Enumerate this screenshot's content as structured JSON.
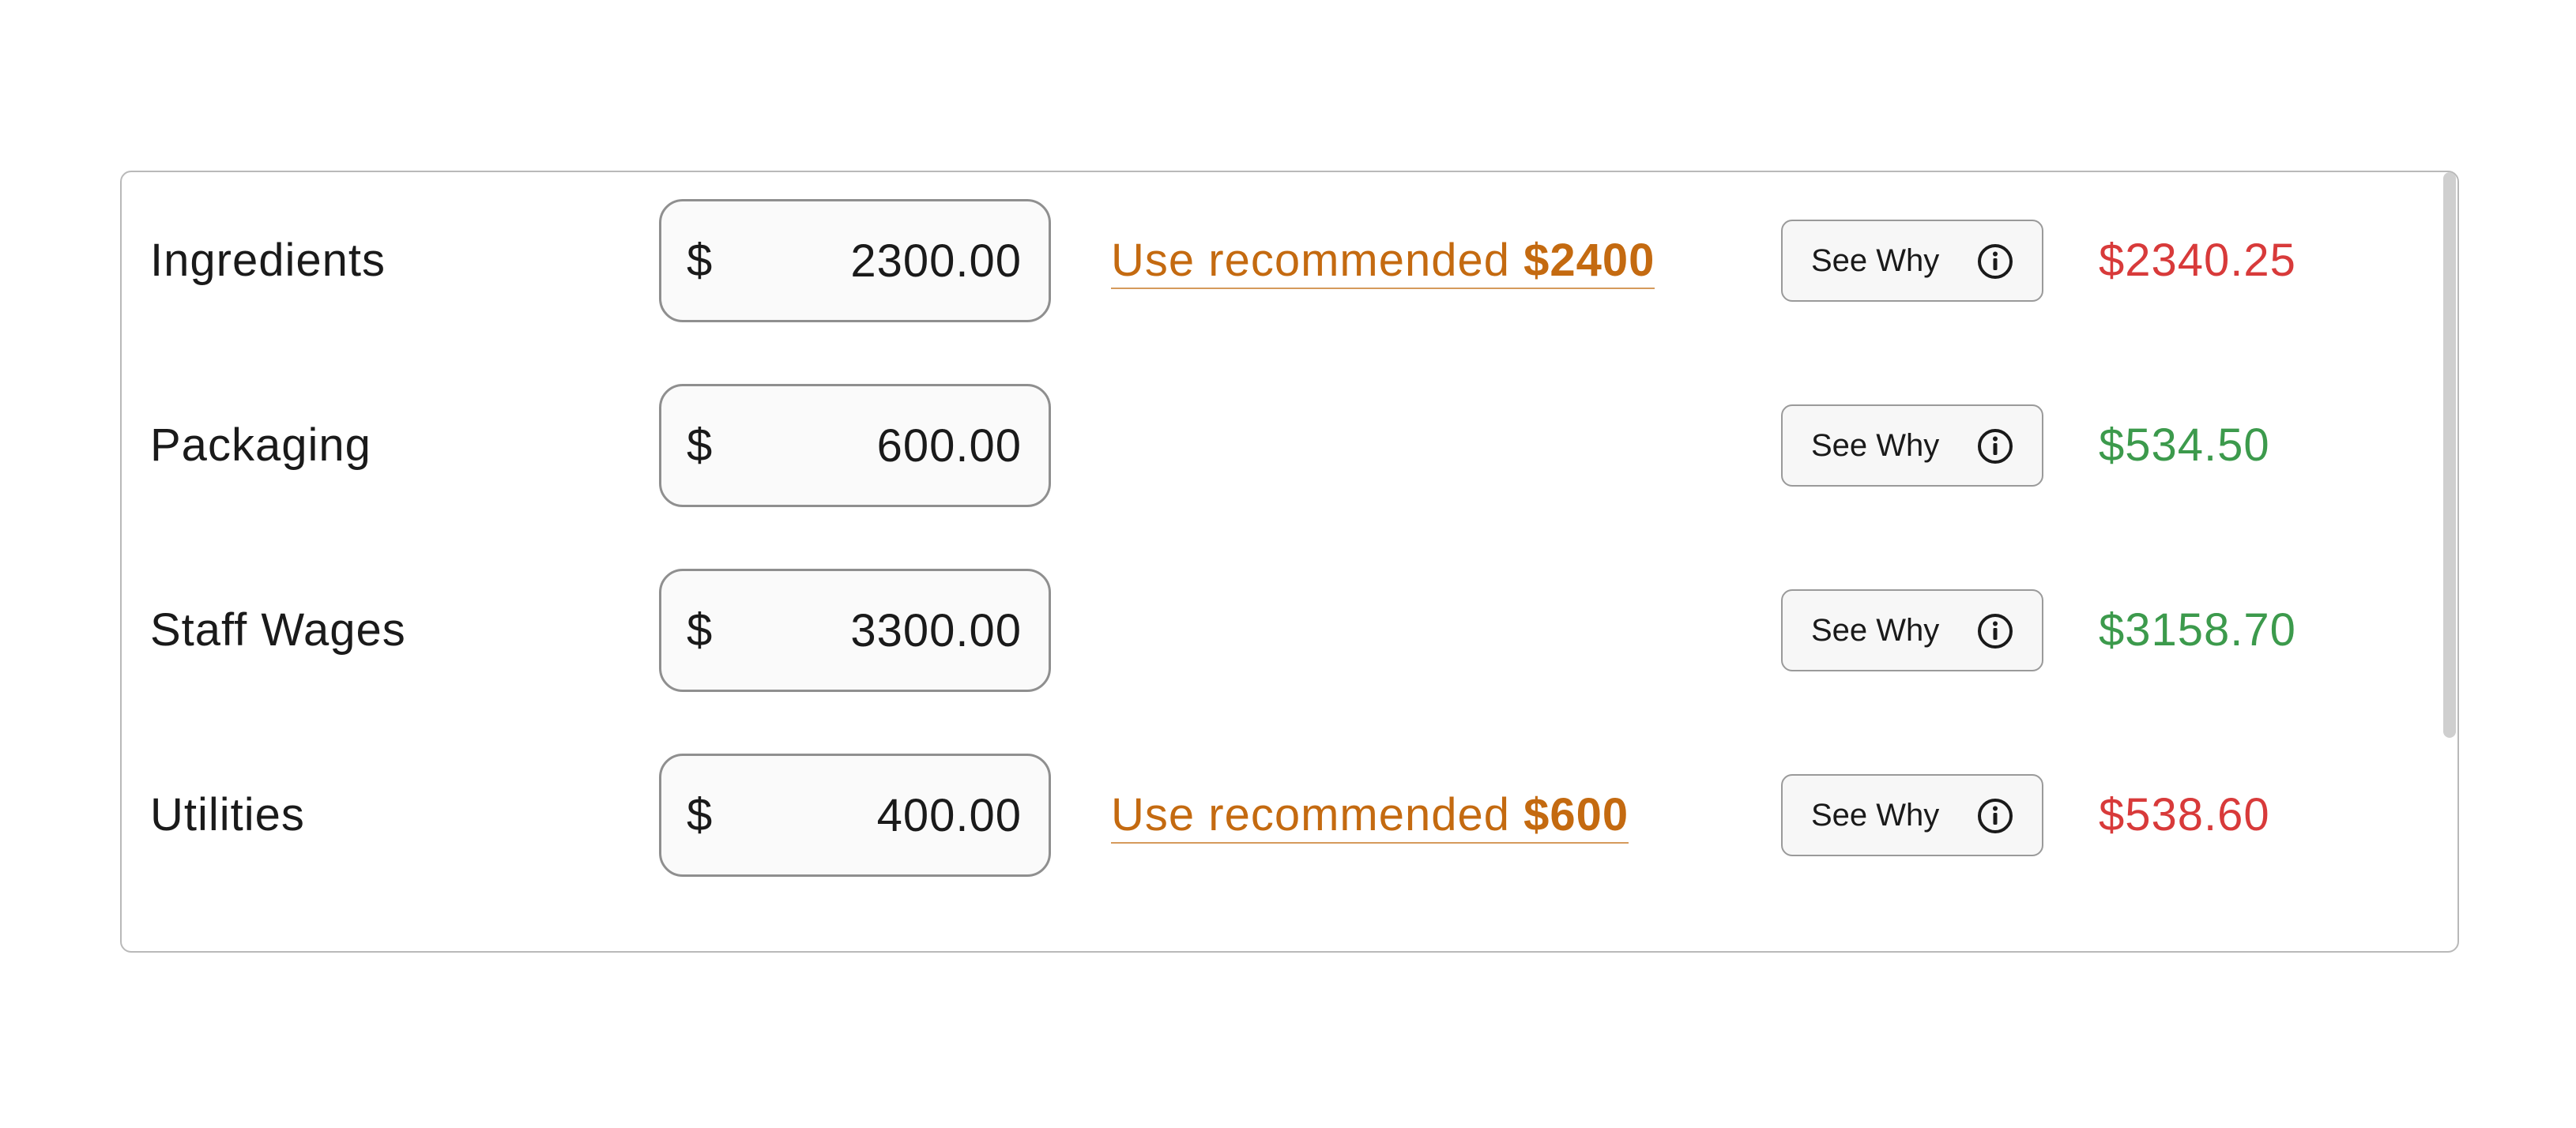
{
  "currency_symbol": "$",
  "see_why_label": "See Why",
  "recommend_prefix": "Use recommended",
  "colors": {
    "recommend_link": "#c46a10",
    "over_budget": "#d83a3a",
    "under_budget": "#3c9a4c"
  },
  "rows": [
    {
      "label": "Ingredients",
      "amount": "2300.00",
      "recommended": "$2400",
      "actual": "$2340.25",
      "actual_status": "over"
    },
    {
      "label": "Packaging",
      "amount": "600.00",
      "recommended": null,
      "actual": "$534.50",
      "actual_status": "under"
    },
    {
      "label": "Staff Wages",
      "amount": "3300.00",
      "recommended": null,
      "actual": "$3158.70",
      "actual_status": "under"
    },
    {
      "label": "Utilities",
      "amount": "400.00",
      "recommended": "$600",
      "actual": "$538.60",
      "actual_status": "over"
    }
  ]
}
